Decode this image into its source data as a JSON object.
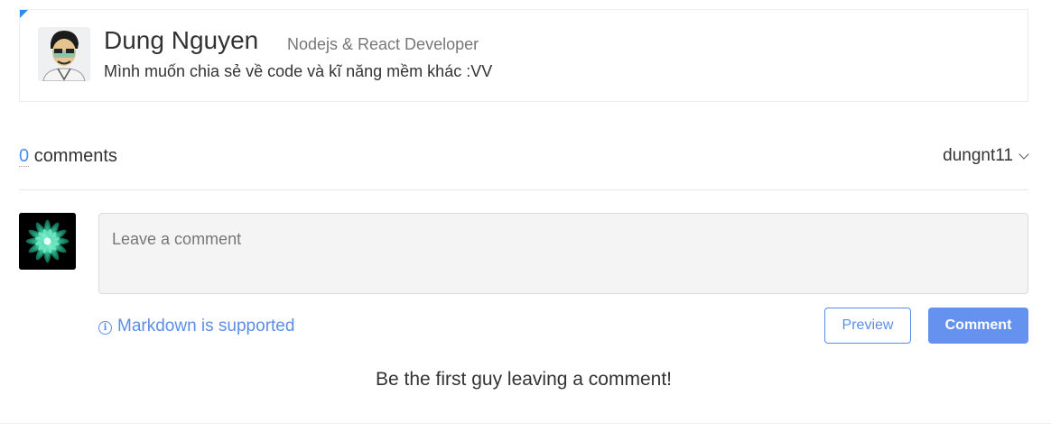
{
  "author": {
    "name": "Dung Nguyen",
    "role": "Nodejs & React Developer",
    "bio": "Mình muốn chia sẻ về code và kĩ năng mềm khác :VV",
    "avatar_icon": "author-portrait-icon"
  },
  "comments": {
    "count": "0",
    "label": "comments",
    "username": "dungnt11",
    "user_avatar_icon": "lotus-flower-icon",
    "placeholder": "Leave a comment",
    "markdown_hint": "Markdown is supported",
    "preview_label": "Preview",
    "submit_label": "Comment",
    "empty_message": "Be the first guy leaving a comment!"
  },
  "colors": {
    "accent": "#5b8fe6",
    "button_bg": "#6592ef",
    "corner": "#2f8bef"
  }
}
